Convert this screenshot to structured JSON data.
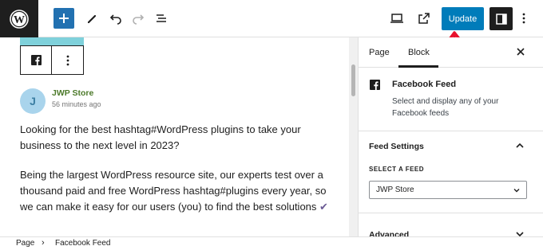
{
  "toolbar": {
    "update_label": "Update"
  },
  "editor": {
    "author": "JWP Store",
    "avatar_initial": "J",
    "timestamp": "56 minutes ago",
    "paragraph1": "Looking for the best hashtag#WordPress plugins to take your business to the next level in 2023?",
    "paragraph2": "Being the largest WordPress resource site, our experts test over a thousand paid and free WordPress hashtag#plugins every year, so we can make it easy for our users (you) to find the best solutions",
    "check_glyph": "✔"
  },
  "sidebar": {
    "tabs": [
      {
        "label": "Page"
      },
      {
        "label": "Block"
      }
    ],
    "block": {
      "title": "Facebook Feed",
      "description": "Select and display any of your Facebook feeds"
    },
    "feed_settings": {
      "title": "Feed Settings",
      "select_label": "SELECT A FEED",
      "selected_value": "JWP Store"
    },
    "advanced": {
      "title": "Advanced"
    }
  },
  "breadcrumb": {
    "items": [
      "Page",
      "Facebook Feed"
    ],
    "separator": "›"
  },
  "colors": {
    "primary": "#007cba",
    "dark": "#1e1e1e",
    "annotation": "#e8112d"
  },
  "icons": [
    "wordpress-logo",
    "plus-icon",
    "pencil-icon",
    "undo-icon",
    "redo-icon",
    "list-view-icon",
    "desktop-preview-icon",
    "external-link-icon",
    "settings-panel-icon",
    "more-vertical-icon",
    "facebook-icon",
    "close-icon",
    "chevron-up-icon",
    "chevron-down-icon"
  ]
}
